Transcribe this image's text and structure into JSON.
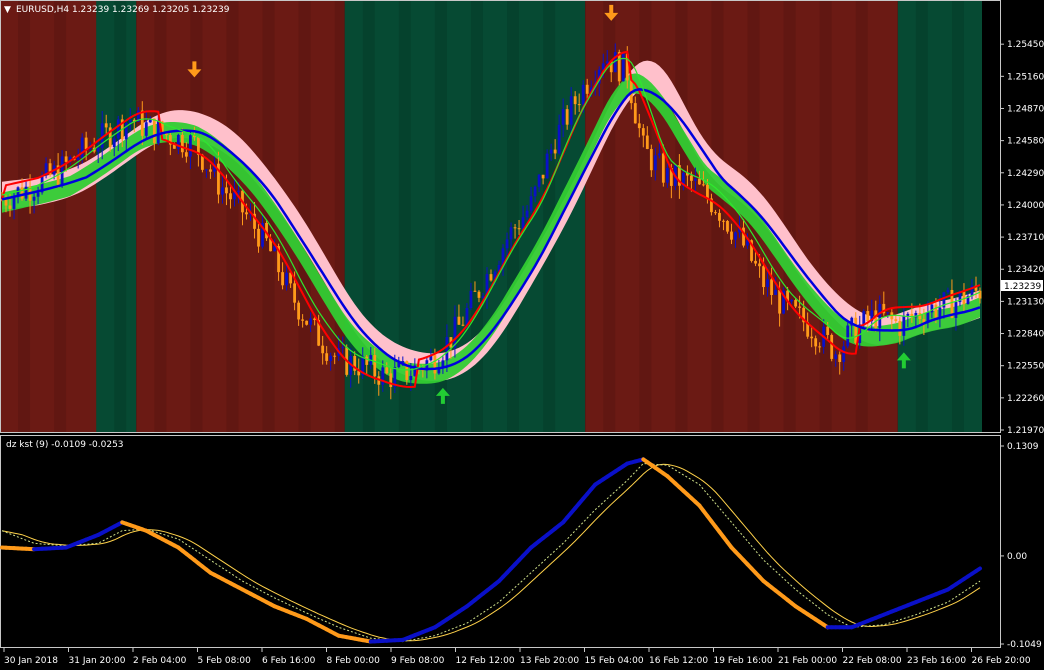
{
  "main_panel": {
    "header": "EURUSD,H4  1.23239 1.23269 1.23205 1.23239",
    "price_ticks": [
      "1.25450",
      "1.25160",
      "1.24870",
      "1.24580",
      "1.24290",
      "1.24000",
      "1.23710",
      "1.23420",
      "1.23130",
      "1.22840",
      "1.22550",
      "1.22260",
      "1.21970"
    ],
    "current_price": "1.23239"
  },
  "indicator_panel": {
    "header": "dz kst (9) -0.0109 -0.0253",
    "ticks": [
      "0.1309",
      "0.00",
      "-0.1049"
    ]
  },
  "time_axis": [
    "30 Jan 2018",
    "31 Jan 20:00",
    "2 Feb 04:00",
    "5 Feb 08:00",
    "6 Feb 16:00",
    "8 Feb 00:00",
    "9 Feb 08:00",
    "12 Feb 12:00",
    "13 Feb 20:00",
    "15 Feb 04:00",
    "16 Feb 12:00",
    "19 Feb 16:00",
    "21 Feb 00:00",
    "22 Feb 08:00",
    "23 Feb 16:00",
    "26 Feb 20:00"
  ],
  "colors": {
    "bear_zone": "#6b1a14",
    "bear_zone_dark": "#5a1511",
    "bull_zone": "#064a33",
    "bull_zone_dark": "#053d2a",
    "bull_candle": "#0a10c8",
    "bear_candle": "#ff9a1a",
    "pink_band": "#ffc0cb",
    "green_band": "#33cc33",
    "red_line": "#ff0000",
    "blue_line": "#0000dd",
    "green_line": "#2ee82e",
    "up_arrow": "#22cc33",
    "down_arrow": "#ff9a1a"
  },
  "arrows": [
    {
      "type": "down",
      "price": 1.2515,
      "time_index": 48
    },
    {
      "type": "down",
      "price": 1.2566,
      "time_index": 152
    },
    {
      "type": "up",
      "price": 1.2235,
      "time_index": 110
    },
    {
      "type": "up",
      "price": 1.2267,
      "time_index": 225
    }
  ],
  "chart_data": {
    "type": "candlestick",
    "symbol": "EURUSD",
    "timeframe": "H4",
    "y_range": [
      1.2197,
      1.2565
    ],
    "indicator_range": [
      -0.1049,
      0.1309
    ],
    "zones": [
      {
        "from": 0,
        "to": 24,
        "state": "bear"
      },
      {
        "from": 24,
        "to": 34,
        "state": "bull"
      },
      {
        "from": 34,
        "to": 86,
        "state": "bear"
      },
      {
        "from": 86,
        "to": 146,
        "state": "bull"
      },
      {
        "from": 146,
        "to": 224,
        "state": "bear"
      },
      {
        "from": 224,
        "to": 245,
        "state": "bull"
      }
    ],
    "mid_price": [
      [
        0,
        1.2405
      ],
      [
        8,
        1.2418
      ],
      [
        14,
        1.243
      ],
      [
        20,
        1.2448
      ],
      [
        26,
        1.2463
      ],
      [
        32,
        1.2478
      ],
      [
        36,
        1.247
      ],
      [
        42,
        1.2462
      ],
      [
        48,
        1.2455
      ],
      [
        54,
        1.242
      ],
      [
        60,
        1.2395
      ],
      [
        66,
        1.2365
      ],
      [
        72,
        1.232
      ],
      [
        78,
        1.2285
      ],
      [
        84,
        1.226
      ],
      [
        90,
        1.2255
      ],
      [
        96,
        1.2245
      ],
      [
        102,
        1.225
      ],
      [
        108,
        1.2262
      ],
      [
        114,
        1.229
      ],
      [
        120,
        1.233
      ],
      [
        126,
        1.237
      ],
      [
        132,
        1.24
      ],
      [
        138,
        1.246
      ],
      [
        144,
        1.25
      ],
      [
        150,
        1.2535
      ],
      [
        156,
        1.252
      ],
      [
        160,
        1.245
      ],
      [
        166,
        1.2425
      ],
      [
        172,
        1.242
      ],
      [
        178,
        1.24
      ],
      [
        184,
        1.237
      ],
      [
        190,
        1.233
      ],
      [
        196,
        1.2305
      ],
      [
        202,
        1.229
      ],
      [
        208,
        1.2268
      ],
      [
        212,
        1.2285
      ],
      [
        218,
        1.23
      ],
      [
        224,
        1.2292
      ],
      [
        230,
        1.2305
      ],
      [
        236,
        1.231
      ],
      [
        244,
        1.2323
      ]
    ],
    "kst": [
      [
        0,
        0.01
      ],
      [
        8,
        0.008
      ],
      [
        16,
        0.01
      ],
      [
        24,
        0.025
      ],
      [
        30,
        0.04
      ],
      [
        36,
        0.03
      ],
      [
        44,
        0.01
      ],
      [
        52,
        -0.02
      ],
      [
        60,
        -0.04
      ],
      [
        68,
        -0.06
      ],
      [
        76,
        -0.075
      ],
      [
        84,
        -0.095
      ],
      [
        92,
        -0.102
      ],
      [
        100,
        -0.1
      ],
      [
        108,
        -0.085
      ],
      [
        116,
        -0.06
      ],
      [
        124,
        -0.03
      ],
      [
        132,
        0.01
      ],
      [
        140,
        0.04
      ],
      [
        148,
        0.085
      ],
      [
        156,
        0.11
      ],
      [
        160,
        0.115
      ],
      [
        166,
        0.095
      ],
      [
        174,
        0.06
      ],
      [
        182,
        0.01
      ],
      [
        190,
        -0.03
      ],
      [
        198,
        -0.06
      ],
      [
        206,
        -0.085
      ],
      [
        212,
        -0.085
      ],
      [
        220,
        -0.07
      ],
      [
        228,
        -0.055
      ],
      [
        236,
        -0.04
      ],
      [
        244,
        -0.015
      ]
    ],
    "kst_signal": [
      [
        0,
        0.03
      ],
      [
        8,
        0.015
      ],
      [
        16,
        0.012
      ],
      [
        24,
        0.015
      ],
      [
        30,
        0.03
      ],
      [
        36,
        0.032
      ],
      [
        44,
        0.02
      ],
      [
        52,
        -0.005
      ],
      [
        60,
        -0.03
      ],
      [
        68,
        -0.05
      ],
      [
        76,
        -0.068
      ],
      [
        84,
        -0.085
      ],
      [
        92,
        -0.098
      ],
      [
        100,
        -0.102
      ],
      [
        108,
        -0.095
      ],
      [
        116,
        -0.08
      ],
      [
        124,
        -0.055
      ],
      [
        132,
        -0.02
      ],
      [
        140,
        0.015
      ],
      [
        148,
        0.055
      ],
      [
        156,
        0.09
      ],
      [
        160,
        0.11
      ],
      [
        166,
        0.108
      ],
      [
        174,
        0.085
      ],
      [
        182,
        0.04
      ],
      [
        190,
        -0.005
      ],
      [
        198,
        -0.04
      ],
      [
        206,
        -0.07
      ],
      [
        212,
        -0.085
      ],
      [
        220,
        -0.082
      ],
      [
        228,
        -0.07
      ],
      [
        236,
        -0.055
      ],
      [
        244,
        -0.03
      ]
    ]
  }
}
